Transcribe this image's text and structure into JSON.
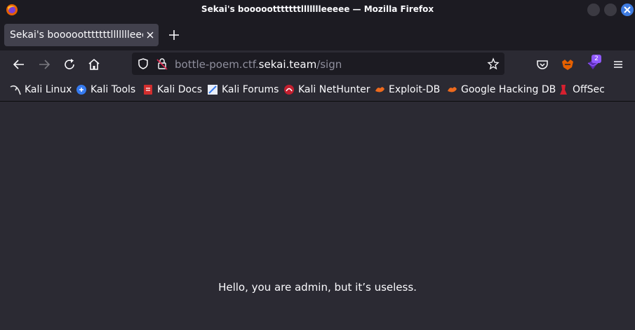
{
  "window": {
    "title": "Sekai's boooootttttttllllllleeeee — Mozilla Firefox"
  },
  "tabs": [
    {
      "label": "Sekai's boooootttttttllllllleeeee",
      "active": true
    }
  ],
  "toolbar": {
    "url_prefix": "bottle-poem.ctf.",
    "url_domain": "sekai.team",
    "url_path": "/sign",
    "extension_badge": "2"
  },
  "bookmarks": [
    {
      "label": "Kali Linux",
      "icon": "kali-dragon-icon"
    },
    {
      "label": "Kali Tools",
      "icon": "kali-tools-icon"
    },
    {
      "label": "Kali Docs",
      "icon": "kali-docs-icon"
    },
    {
      "label": "Kali Forums",
      "icon": "kali-forums-icon"
    },
    {
      "label": "Kali NetHunter",
      "icon": "kali-nethunter-icon"
    },
    {
      "label": "Exploit-DB",
      "icon": "exploit-db-icon"
    },
    {
      "label": "Google Hacking DB",
      "icon": "ghdb-icon"
    },
    {
      "label": "OffSec",
      "icon": "offsec-icon"
    }
  ],
  "page": {
    "message": "Hello, you are admin, but it’s useless."
  },
  "colors": {
    "chrome_dark": "#1c1b22",
    "chrome": "#2b2a33",
    "active_tab": "#42414d",
    "accent_blue": "#3e7be0",
    "badge_purple": "#9059ff"
  }
}
